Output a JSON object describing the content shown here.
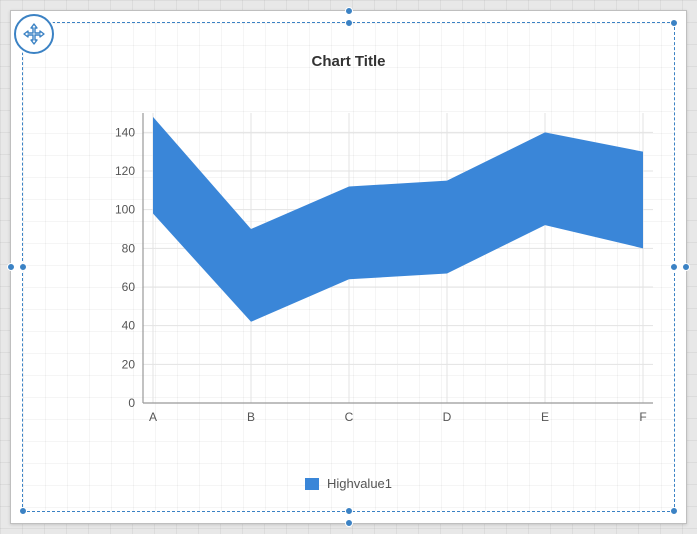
{
  "title": "Chart Title",
  "legend": {
    "label": "Highvalue1"
  },
  "colors": {
    "series": "#3a86d8",
    "handle": "#3b82c4",
    "axis": "#999999",
    "grid": "#e3e3e3",
    "text": "#555555"
  },
  "chart_data": {
    "type": "area",
    "title": "Chart Title",
    "xlabel": "",
    "ylabel": "",
    "categories": [
      "A",
      "B",
      "C",
      "D",
      "E",
      "F"
    ],
    "series": [
      {
        "name": "Highvalue1",
        "high": [
          148,
          90,
          112,
          115,
          140,
          130
        ],
        "low": [
          98,
          42,
          64,
          67,
          92,
          80
        ]
      }
    ],
    "ylim": [
      0,
      150
    ],
    "yticks": [
      0,
      20,
      40,
      60,
      80,
      100,
      120,
      140
    ],
    "grid": true,
    "legend_position": "bottom"
  }
}
